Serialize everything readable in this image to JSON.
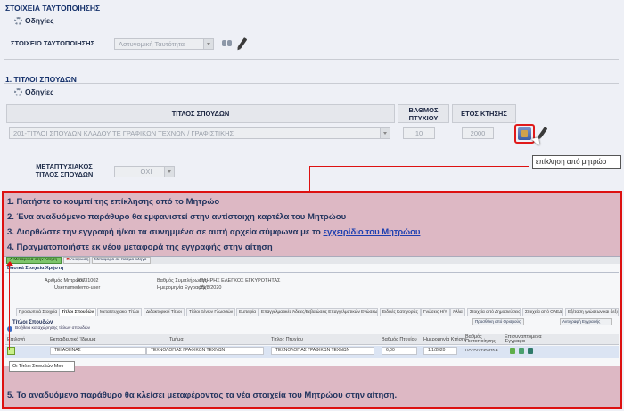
{
  "section1": {
    "title": "ΣΤΟΙΧΕΙΑ ΤΑΥΤΟΠΟΙΗΣΗΣ",
    "instructions": "Οδηγίες",
    "id_label": "ΣΤΟΙΧΕΙΟ ΤΑΥΤΟΠΟΙΗΣΗΣ",
    "id_value": "Αστυνομική Ταυτότητα"
  },
  "section2": {
    "title": "1. ΤΙΤΛΟΙ ΣΠΟΥΔΩΝ",
    "instructions": "Οδηγίες",
    "col_title": "ΤΙΤΛΟΣ ΣΠΟΥΔΩΝ",
    "col_grade": "ΒΑΘΜΟΣ ΠΤΥΧΙΟΥ",
    "col_year": "ΕΤΟΣ ΚΤΗΣΗΣ",
    "row_title": "201-ΤΙΤΛΟΙ ΣΠΟΥΔΩΝ ΚΛΑΔΟΥ ΤΕ ΓΡΑΦΙΚΩΝ ΤΕΧΝΩΝ / ΓΡΑΦΙΣΤΙΚΗΣ",
    "row_grade": "10",
    "row_year": "2000",
    "postgrad_label": "ΜΕΤΑΠΤΥΧΙΑΚΟΣ ΤΙΤΛΟΣ ΣΠΟΥΔΩΝ",
    "postgrad_value": "ΟΧΙ",
    "tooltip": "επίκληση από μητρώο"
  },
  "instructions_box": {
    "step1": "1.  Πατήστε το κουμπί της επίκλησης από το Μητρώο",
    "step2": "2.  Ένα αναδυόμενο παράθυρο θα εμφανιστεί στην αντίστοιχη καρτέλα του Μητρώου",
    "step3_pre": "3.  Διορθώστε την εγγραφή ή/και τα συνημμένα σε αυτή αρχεία σύμφωνα με το ",
    "step3_link": "εγχειρίδιο του Μητρώου",
    "step4": "4.  Πραγματοποιήστε εκ νέου μεταφορά της εγγραφής στην αίτηση",
    "step5": "5.  Το αναδυόμενο παράθυρο θα κλείσει μεταφέροντας τα νέα στοιχεία του Μητρώου στην αίτηση."
  },
  "popup": {
    "btn_transfer": "Μεταφορά στην Αίτηση",
    "btn_cancel": "Ακύρωση",
    "btn_transfer_close": "Μεταφορά σε πάθμα οδηγό",
    "header": "Βασικά Στοιχεία Χρήστη",
    "reg_no_label": "Αριθμός Μητρώου",
    "reg_no": "00731002",
    "username_label": "Username",
    "username": "demo-user",
    "completeness_label": "Βαθμός Συμπλήρωσης",
    "completeness": "ΠΛΗΡΗΣ ΕΛΕΓΧΟΣ ΕΓΚΥΡΟΤΗΤΑΣ",
    "date_label": "Ημερομηνία Εγγραφής",
    "date": "25/8/2020",
    "tabs": [
      "Προσωπικά Στοιχεία",
      "Τίτλοι Σπουδών",
      "Μεταπτυχιακοί Τίτλοι",
      "Διδακτορικοί Τίτλοι",
      "Τίτλοι Ξένων Γλωσσών",
      "Εμπειρία",
      "Επαγγελματικές Άδειες/Βεβαιώσεις Επαγγελματικών Ενώσεων",
      "Ειδικές Κατηγορίες",
      "Γνώσεις Η/Υ",
      "Άλλα",
      "Στοιχεία από Δημοσιεύσεις",
      "Στοιχεία από ΟΑΕΔ",
      "Εξέταση γνώσεων και δεξιοτήτων"
    ],
    "section_title": "Τίτλοι Σπουδών",
    "help_text": "Βοήθεια καταχώρησης τίτλων σπουδών",
    "add_btn": "Προσθήκη από Ορισμούς",
    "new_btn": "Αντιγραφή Εγγραφής",
    "col_select": "Επιλογή",
    "col_school": "Εκπαιδευτικό Ίδρυμα",
    "col_dept": "Τμήμα",
    "col_degree": "Τίτλος Πτυχίου",
    "col_grade": "Βαθμός Πτυχίου",
    "col_date": "Ημερομηνία Κτήσης",
    "col_type": "Βαθμός Πιστοποίησης",
    "col_files": "Επισυναπτόμενα Έγγραφα",
    "row_school": "ΤΕΙ ΑΘΗΝΑΣ",
    "row_dept": "ΤΕΧΝΟΛΟΓΙΑΣ ΓΡΑΦΙΚΩΝ ΤΕΧΝΩΝ",
    "row_degree": "ΤΕΧΝΟΛΟΓΙΑΣ ΓΡΑΦΙΚΩΝ ΤΕΧΝΩΝ",
    "row_grade": "6,00",
    "row_date": "1/1/2020",
    "row_type": "ΠΑΡΑΛΗΦΘΗΚΕ",
    "tooltip": "Οι Τίτλοι Σπουδών Μου"
  }
}
